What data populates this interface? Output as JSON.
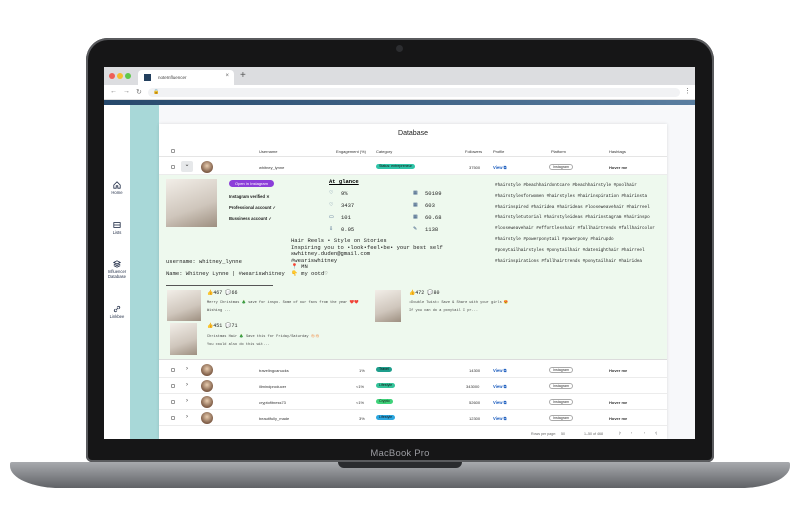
{
  "device": {
    "label": "MacBook Pro"
  },
  "browser": {
    "tab_title": "noteInfluencer",
    "close_glyph": "×",
    "new_tab_glyph": "+",
    "back": "←",
    "forward": "→",
    "reload": "↻",
    "lock": "🔒",
    "menu": "⋮"
  },
  "sidebar": {
    "items": [
      {
        "label": "Home",
        "icon": "home-icon"
      },
      {
        "label": "Lists",
        "icon": "list-icon"
      },
      {
        "label": "Influencer Database",
        "icon": "database-icon"
      },
      {
        "label": "Linkbee",
        "icon": "link-icon"
      }
    ]
  },
  "table": {
    "title": "Database",
    "columns": [
      "Username",
      "Engagement (%)",
      "Category",
      "Followers",
      "Profile",
      "Platform",
      "Hashtags"
    ],
    "rows": [
      {
        "username": "whitney_lynne",
        "engagement": "",
        "category": "Status: entrepreneur",
        "category_color": "#2fc4a8",
        "followers": "37500",
        "profile": "View",
        "platform": "Instagram",
        "hashtags": "Hover me",
        "expand": "⌄"
      },
      {
        "username": "travelingcanucks",
        "engagement": "1%",
        "category": "Travel",
        "category_color": "#1e9e8c",
        "followers": "14300",
        "profile": "View",
        "platform": "Instagram",
        "hashtags": "Hover me",
        "expand": "›"
      },
      {
        "username": "illmindproducer",
        "engagement": "<1%",
        "category": "Lifestyle",
        "category_color": "#34c39a",
        "followers": "343000",
        "profile": "View",
        "platform": "Instagram",
        "hashtags": "",
        "expand": "›"
      },
      {
        "username": "cryptofitness73",
        "engagement": "<1%",
        "category": "Crypto",
        "category_color": "#3fd27a",
        "followers": "52600",
        "profile": "View",
        "platform": "Instagram",
        "hashtags": "Hover me",
        "expand": "›"
      },
      {
        "username": "beautifully_made",
        "engagement": "3%",
        "category": "Lifestyle",
        "category_color": "#2ca7e0",
        "followers": "12300",
        "profile": "View",
        "platform": "Instagram",
        "hashtags": "Hover me",
        "expand": "›"
      }
    ],
    "footer": {
      "rows_per_page": "Rows per page:",
      "rows_value": "50",
      "range": "1–50 of 468",
      "first": "|‹",
      "prev": "‹",
      "next": "›",
      "last": "›|"
    }
  },
  "expanded": {
    "open_button": "Open in Instagram",
    "flags": [
      "Instagram verified ✕",
      "Professional account ✓",
      "Bussiness account ✓"
    ],
    "glance_title": "At glance",
    "stats_left": [
      {
        "icon": "heart-icon",
        "glyph": "♡",
        "value": "9%"
      },
      {
        "icon": "like-icon",
        "glyph": "♡",
        "value": "3437"
      },
      {
        "icon": "comment-icon",
        "glyph": "▭",
        "value": "101"
      },
      {
        "icon": "thumb-icon",
        "glyph": "⇩",
        "value": "0.05"
      }
    ],
    "stats_right": [
      {
        "icon": "followers-icon",
        "glyph": "▦",
        "value": "50109"
      },
      {
        "icon": "posts-icon",
        "glyph": "▦",
        "value": "603"
      },
      {
        "icon": "ratio-icon",
        "glyph": "▦",
        "value": "60.68"
      },
      {
        "icon": "edit-icon",
        "glyph": "✎",
        "value": "1138"
      }
    ],
    "username_line": "username: whitney_lynne",
    "name_line": "Name: Whitney Lynne | #weariswhitney",
    "bio": "Hair Reels • Style on Stories\nInspiring you to •look•feel•be• your best self\n✉whitney.duden@gmail.com\n#weariswhitney\n📍 MN\n👇 my ootd♡",
    "hashtags": "#hairstyle #beachhairdontcare #beachhairstyle #poolhair #hairstylesforwomen #hairstyles #hairinspiration #hairinsta #hairinspired #hairidea #hairideas #looseweavehair #hairreel #hairstyletutorial #hairstyleideas #hairinstagram #hairinspo #looseweavehair #effortlesshair #fallhairtrends #fallhaircolor #hairstyle #powerponytail #powerpony #hairupdo #ponytailhairstyles #ponytailhair #datenighthair #hairreel #hairinspirations #fallhairtrends #ponytailhair #hairidea",
    "posts": [
      {
        "likes": "👍467 💬66",
        "caption1": "Merry Christmas 🎄 save for inspo. Some of our favs from the year ❤️❤️",
        "caption2": "Wishing ..."
      },
      {
        "likes": "👍451 💬71",
        "caption1": "Christmas Hair 🎄 Save this for Friday/Saturday 👏🏻👏🏻",
        "caption2": "You could also do this wit..."
      },
      {
        "likes": "👍472 💬80",
        "caption1": "•Double Twist• Save & Share with your girls 😍",
        "caption2": "If you can do a ponytail I pr..."
      }
    ]
  }
}
